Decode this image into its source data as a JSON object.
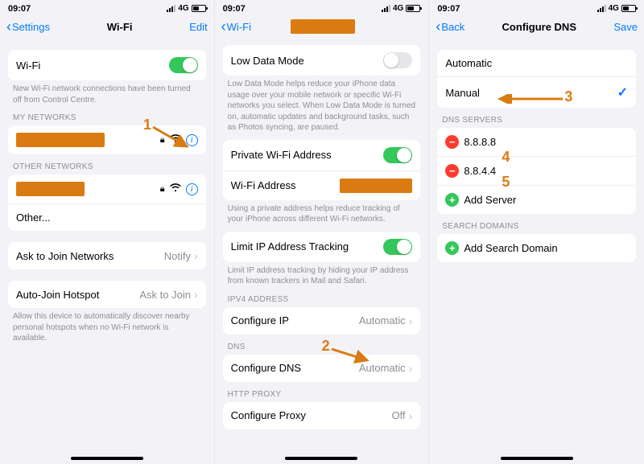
{
  "status": {
    "time": "09:07",
    "net": "4G"
  },
  "p1": {
    "nav": {
      "back": "Settings",
      "title": "Wi-Fi",
      "right": "Edit"
    },
    "wifi_label": "Wi-Fi",
    "note_cc": "New Wi-Fi network connections have been turned off from Control Centre.",
    "my_networks": "MY NETWORKS",
    "other_networks": "OTHER NETWORKS",
    "other": "Other...",
    "ask_join": "Ask to Join Networks",
    "ask_join_val": "Notify",
    "auto_hotspot": "Auto-Join Hotspot",
    "auto_hotspot_val": "Ask to Join",
    "note_hotspot": "Allow this device to automatically discover nearby personal hotspots when no Wi-Fi network is available."
  },
  "p2": {
    "nav": {
      "back": "Wi-Fi"
    },
    "low_data": "Low Data Mode",
    "low_data_note": "Low Data Mode helps reduce your iPhone data usage over your mobile network or specific Wi-Fi networks you select. When Low Data Mode is turned on, automatic updates and background tasks, such as Photos syncing, are paused.",
    "priv_addr": "Private Wi-Fi Address",
    "wifi_addr": "Wi-Fi Address",
    "priv_note": "Using a private address helps reduce tracking of your iPhone across different Wi-Fi networks.",
    "limit_track": "Limit IP Address Tracking",
    "limit_note": "Limit IP address tracking by hiding your IP address from known trackers in Mail and Safari.",
    "ipv4_hdr": "IPV4 ADDRESS",
    "conf_ip": "Configure IP",
    "conf_ip_val": "Automatic",
    "dns_hdr": "DNS",
    "conf_dns": "Configure DNS",
    "conf_dns_val": "Automatic",
    "proxy_hdr": "HTTP PROXY",
    "conf_proxy": "Configure Proxy",
    "conf_proxy_val": "Off"
  },
  "p3": {
    "nav": {
      "back": "Back",
      "title": "Configure DNS",
      "right": "Save"
    },
    "automatic": "Automatic",
    "manual": "Manual",
    "dns_hdr": "DNS SERVERS",
    "server1": "8.8.8.8",
    "server2": "8.8.4.4",
    "add_server": "Add Server",
    "search_hdr": "SEARCH DOMAINS",
    "add_domain": "Add Search Domain"
  },
  "anno": {
    "n1": "1",
    "n2": "2",
    "n3": "3",
    "n4": "4",
    "n5": "5"
  }
}
